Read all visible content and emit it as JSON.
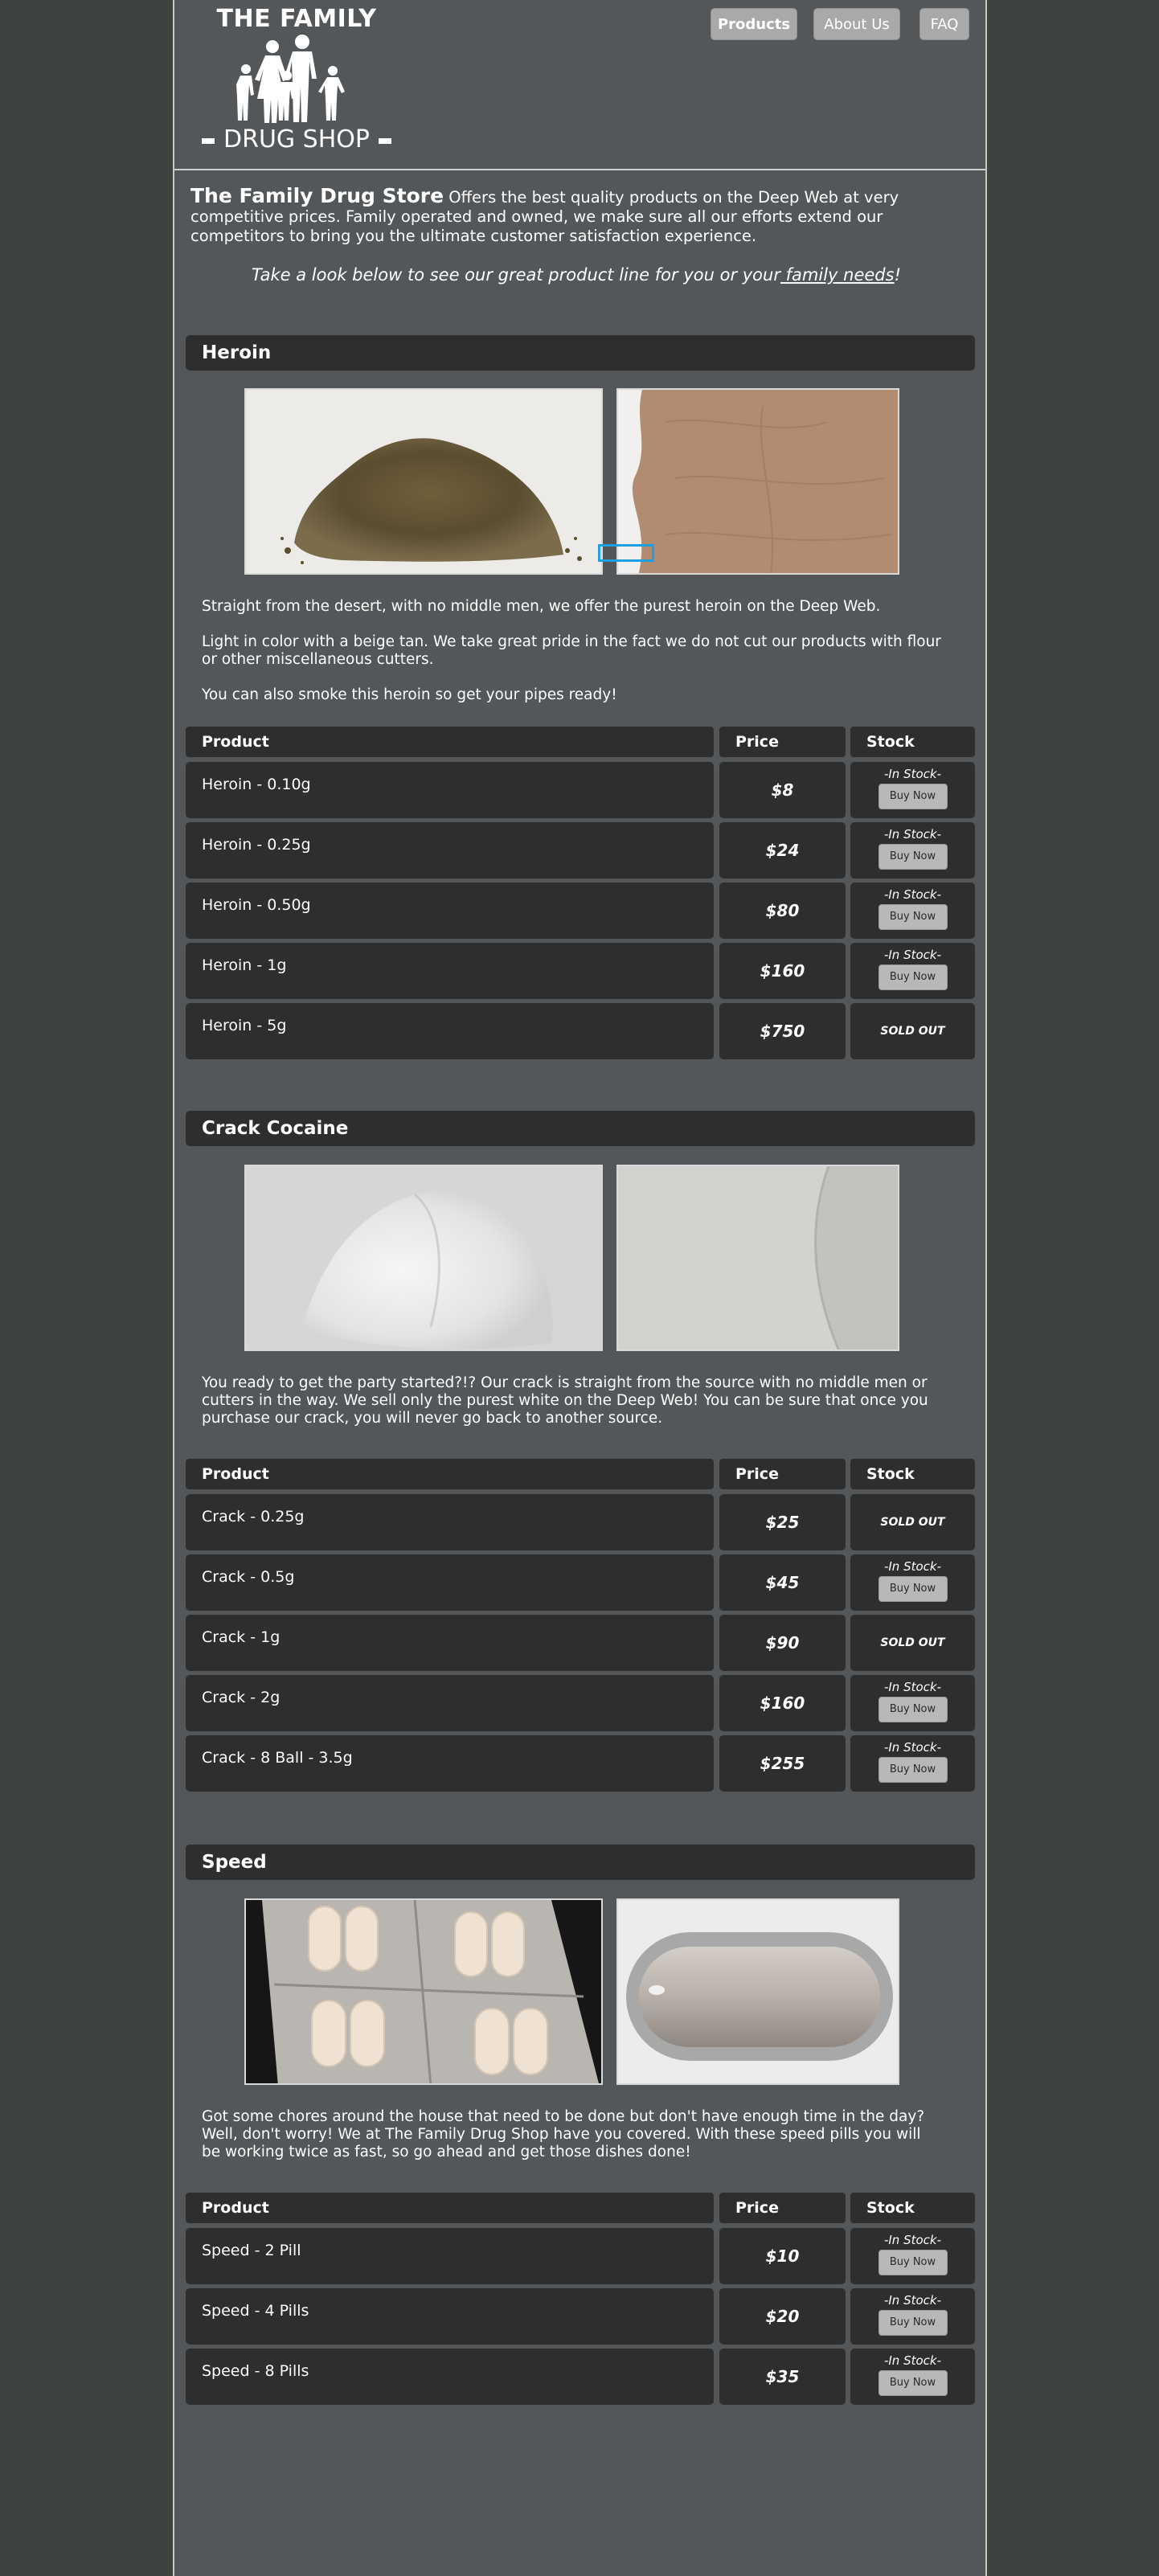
{
  "logo": {
    "top": "THE FAMILY",
    "bottom": "DRUG SHOP"
  },
  "nav": [
    {
      "label": "Products",
      "active": true
    },
    {
      "label": "About Us",
      "active": false
    },
    {
      "label": "FAQ",
      "active": false
    }
  ],
  "intro": {
    "brand": "The Family Drug Store",
    "text": " Offers the best quality products on the Deep Web at very competitive prices. Family operated and owned, we make sure all our efforts extend our competitors to bring you the ultimate customer satisfaction experience."
  },
  "tagline": {
    "text": "Take a look below to see our great product line for you or your",
    "link": " family needs",
    "end": "!"
  },
  "table_headers": {
    "product": "Product",
    "price": "Price",
    "stock": "Stock"
  },
  "stock_labels": {
    "in_stock": "-In Stock-",
    "buy": "Buy Now",
    "sold_out": "SOLD OUT"
  },
  "sections": [
    {
      "title": "Heroin",
      "paragraphs": [
        "Straight from the desert, with no middle men, we offer the purest heroin on the Deep Web.",
        "Light in color with a beige tan. We take great pride in the fact we do not cut our products with flour or other miscellaneous cutters.",
        "You can also smoke this heroin so get your pipes ready!"
      ],
      "products": [
        {
          "name": "Heroin - 0.10g",
          "price": "$8",
          "in_stock": true
        },
        {
          "name": "Heroin - 0.25g",
          "price": "$24",
          "in_stock": true
        },
        {
          "name": "Heroin - 0.50g",
          "price": "$80",
          "in_stock": true
        },
        {
          "name": "Heroin - 1g",
          "price": "$160",
          "in_stock": true
        },
        {
          "name": "Heroin - 5g",
          "price": "$750",
          "in_stock": false
        }
      ]
    },
    {
      "title": "Crack Cocaine",
      "paragraphs": [
        "You ready to get the party started?!? Our crack is straight from the source with no middle men or cutters in the way. We sell only the purest white on the Deep Web! You can be sure that once you purchase our crack, you will never go back to another source."
      ],
      "products": [
        {
          "name": "Crack - 0.25g",
          "price": "$25",
          "in_stock": false
        },
        {
          "name": "Crack - 0.5g",
          "price": "$45",
          "in_stock": true
        },
        {
          "name": "Crack - 1g",
          "price": "$90",
          "in_stock": false
        },
        {
          "name": "Crack - 2g",
          "price": "$160",
          "in_stock": true
        },
        {
          "name": "Crack - 8 Ball - 3.5g",
          "price": "$255",
          "in_stock": true
        }
      ]
    },
    {
      "title": "Speed",
      "paragraphs": [
        "Got some chores around the house that need to be done but don't have enough time in the day? Well, don't worry! We at The Family Drug Shop have you covered. With these speed pills you will be working twice as fast, so go ahead and get those dishes done!"
      ],
      "products": [
        {
          "name": "Speed - 2 Pill",
          "price": "$10",
          "in_stock": true
        },
        {
          "name": "Speed - 4 Pills",
          "price": "$20",
          "in_stock": true
        },
        {
          "name": "Speed  - 8 Pills",
          "price": "$35",
          "in_stock": true
        }
      ]
    }
  ],
  "colors": {
    "background": "#3d433f",
    "page": "#545759",
    "panel": "#2e2e2e",
    "button": "#a9a9a9",
    "focus": "#1fa0de"
  }
}
